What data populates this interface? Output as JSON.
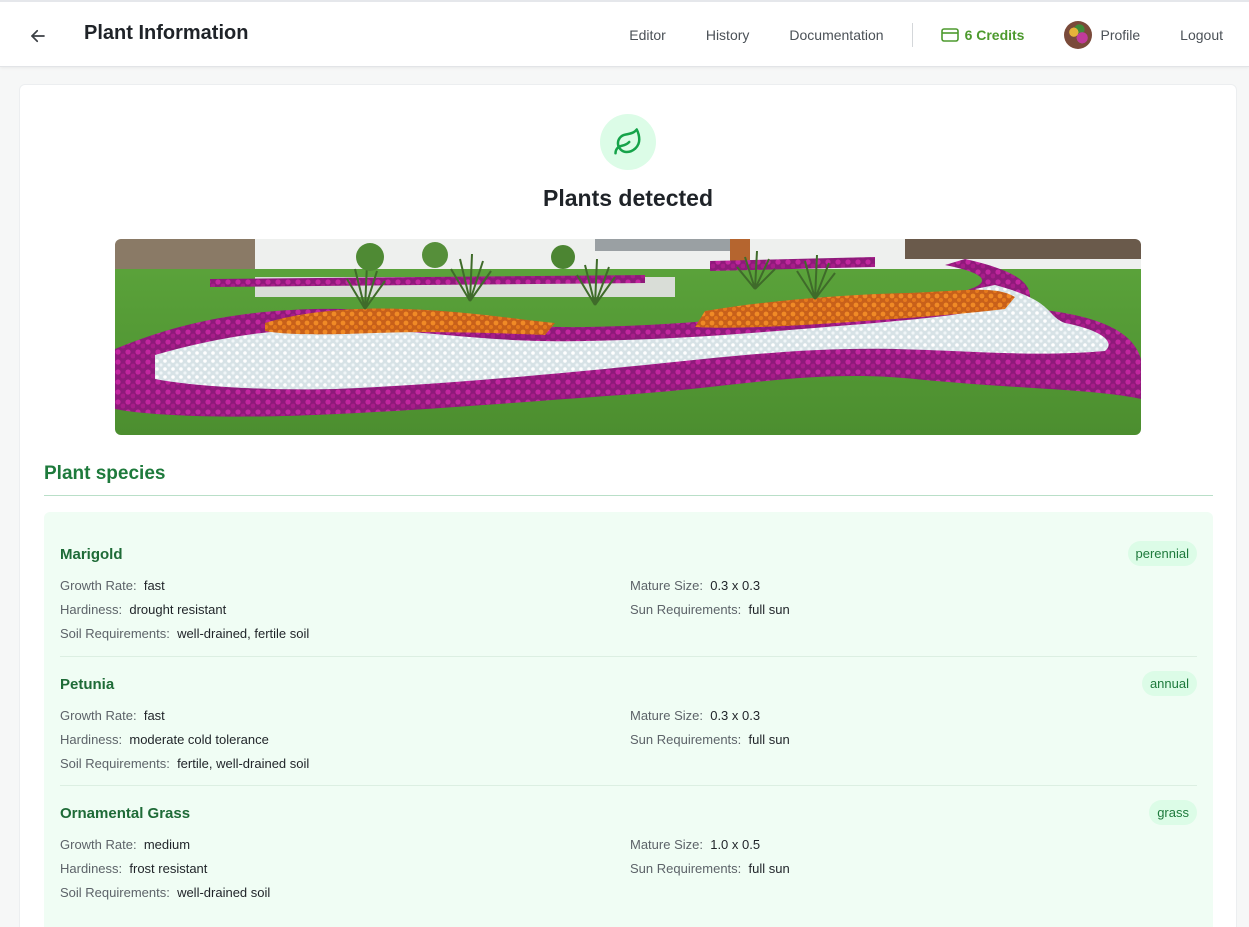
{
  "header": {
    "title": "Plant Information",
    "nav": {
      "editor": "Editor",
      "history": "History",
      "documentation": "Documentation",
      "credits": "6 Credits",
      "profile": "Profile",
      "logout": "Logout"
    }
  },
  "main": {
    "heading": "Plants detected",
    "section_title": "Plant species",
    "plants": [
      {
        "name": "Marigold",
        "type": "perennial",
        "growth_rate_label": "Growth Rate:",
        "growth_rate": "fast",
        "hardiness_label": "Hardiness:",
        "hardiness": "drought resistant",
        "soil_label": "Soil Requirements:",
        "soil": "well-drained, fertile soil",
        "mature_size_label": "Mature Size:",
        "mature_size": "0.3 x 0.3",
        "sun_label": "Sun Requirements:",
        "sun": "full sun"
      },
      {
        "name": "Petunia",
        "type": "annual",
        "growth_rate_label": "Growth Rate:",
        "growth_rate": "fast",
        "hardiness_label": "Hardiness:",
        "hardiness": "moderate cold tolerance",
        "soil_label": "Soil Requirements:",
        "soil": "fertile, well-drained soil",
        "mature_size_label": "Mature Size:",
        "mature_size": "0.3 x 0.3",
        "sun_label": "Sun Requirements:",
        "sun": "full sun"
      },
      {
        "name": "Ornamental Grass",
        "type": "grass",
        "growth_rate_label": "Growth Rate:",
        "growth_rate": "medium",
        "hardiness_label": "Hardiness:",
        "hardiness": "frost resistant",
        "soil_label": "Soil Requirements:",
        "soil": "well-drained soil",
        "mature_size_label": "Mature Size:",
        "mature_size": "1.0 x 0.5",
        "sun_label": "Sun Requirements:",
        "sun": "full sun"
      }
    ]
  },
  "icons": {
    "back": "arrow-left-icon",
    "credits": "credit-card-icon",
    "hero": "leaf-icon"
  },
  "colors": {
    "accent_green": "#1e7a3c",
    "credits_green": "#4d9a2e",
    "species_bg": "#f0fdf4",
    "badge_bg": "#dcfce7"
  }
}
